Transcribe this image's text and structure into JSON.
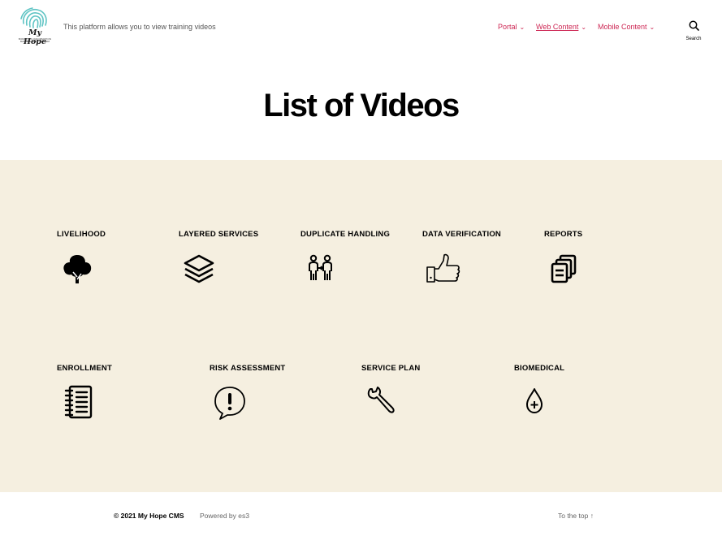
{
  "header": {
    "logo": {
      "brand": "My Hope",
      "sub_line1": "BIOMETRIC INFORMATION",
      "sub_line2": "MANAGEMENT SYSTEM"
    },
    "tagline": "This platform allows you to view training videos",
    "nav": [
      {
        "label": "Portal"
      },
      {
        "label": "Web Content"
      },
      {
        "label": "Mobile Content"
      }
    ],
    "search_label": "Search",
    "accent_color": "#cd2653"
  },
  "page_title": "List of Videos",
  "content_bg": "#f5efe0",
  "categories_row1": [
    {
      "label": "LIVELIHOOD",
      "icon": "tree-icon"
    },
    {
      "label": "LAYERED SERVICES",
      "icon": "layers-icon"
    },
    {
      "label": "DUPLICATE HANDLING",
      "icon": "people-transfer-icon"
    },
    {
      "label": "DATA VERIFICATION",
      "icon": "thumbs-up-icon"
    },
    {
      "label": "REPORTS",
      "icon": "documents-icon"
    }
  ],
  "categories_row2": [
    {
      "label": "ENROLLMENT",
      "icon": "notebook-icon"
    },
    {
      "label": "RISK ASSESSMENT",
      "icon": "alert-speech-icon"
    },
    {
      "label": "SERVICE PLAN",
      "icon": "wrench-icon"
    },
    {
      "label": "BIOMEDICAL",
      "icon": "blood-drop-icon"
    }
  ],
  "footer": {
    "copyright": "© 2021 My Hope CMS",
    "powered": "Powered by es3",
    "to_top": "To the top ↑"
  }
}
